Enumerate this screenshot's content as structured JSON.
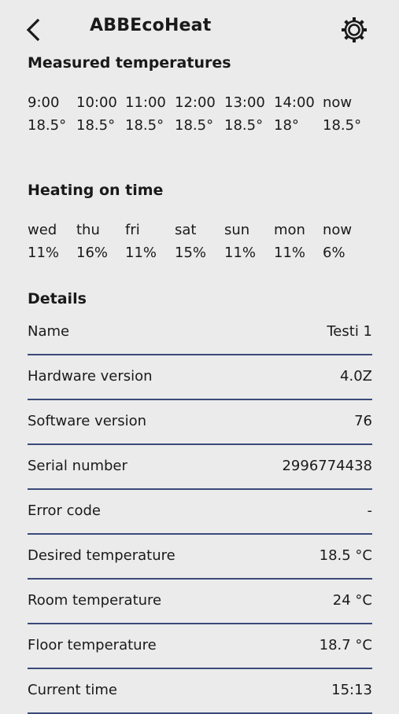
{
  "header": {
    "title": "ABBEcoHeat",
    "back_icon": "chevron-left-icon",
    "settings_icon": "gear-icon"
  },
  "measured": {
    "title": "Measured temperatures",
    "times": [
      "9:00",
      "10:00",
      "11:00",
      "12:00",
      "13:00",
      "14:00",
      "now"
    ],
    "values": [
      "18.5°",
      "18.5°",
      "18.5°",
      "18.5°",
      "18.5°",
      "18°",
      "18.5°"
    ]
  },
  "heating": {
    "title": "Heating on time",
    "days": [
      "wed",
      "thu",
      "fri",
      "sat",
      "sun",
      "mon",
      "now"
    ],
    "values": [
      "11%",
      "16%",
      "11%",
      "15%",
      "11%",
      "11%",
      "6%"
    ]
  },
  "details": {
    "title": "Details",
    "rows": [
      {
        "label": "Name",
        "value": "Testi 1"
      },
      {
        "label": "Hardware version",
        "value": "4.0Z"
      },
      {
        "label": "Software version",
        "value": "76"
      },
      {
        "label": "Serial number",
        "value": "2996774438"
      },
      {
        "label": "Error code",
        "value": "-"
      },
      {
        "label": "Desired temperature",
        "value": "18.5 °C"
      },
      {
        "label": "Room temperature",
        "value": "24 °C"
      },
      {
        "label": "Floor temperature",
        "value": "18.7 °C"
      },
      {
        "label": "Current time",
        "value": "15:13"
      }
    ]
  },
  "colors": {
    "background": "#ebebeb",
    "divider": "#3b4a7a",
    "text": "#1a1a1a"
  }
}
